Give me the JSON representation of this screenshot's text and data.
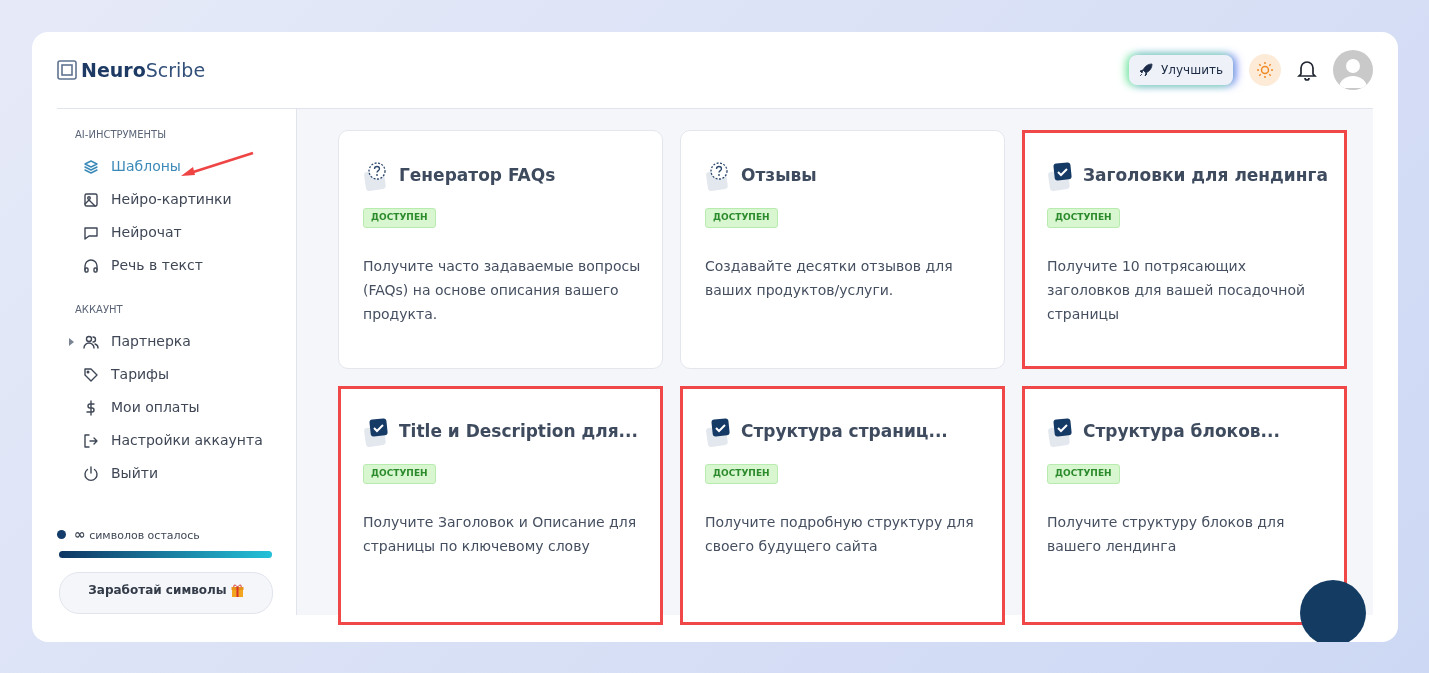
{
  "brand": {
    "bold": "Neuro",
    "light": "Scribe"
  },
  "header": {
    "upgrade_button": "Улучшить"
  },
  "sidebar": {
    "sections": [
      {
        "title": "AI-ИНСТРУМЕНТЫ",
        "items": [
          {
            "label": "Шаблоны",
            "selected": true,
            "annotated": true
          },
          {
            "label": "Нейро-картинки",
            "selected": false,
            "annotated": false
          },
          {
            "label": "Нейрочат",
            "selected": false,
            "annotated": false
          },
          {
            "label": "Речь в текст",
            "selected": false,
            "annotated": false
          }
        ]
      },
      {
        "title": "АККАУНТ",
        "items": [
          {
            "label": "Партнерка",
            "selected": false,
            "annotated": false,
            "expanded": false
          },
          {
            "label": "Тарифы",
            "selected": false,
            "annotated": false
          },
          {
            "label": "Мои оплаты",
            "selected": false,
            "annotated": false
          },
          {
            "label": "Настройки аккаунта",
            "selected": false,
            "annotated": false
          },
          {
            "label": "Выйти",
            "selected": false,
            "annotated": false
          }
        ]
      }
    ],
    "credits": {
      "amount": "∞",
      "label": "символов осталось",
      "level": 1
    },
    "earn_button": "Заработай символы"
  },
  "cards": [
    {
      "kind": "question",
      "title": "Генератор FAQs",
      "badge": "ДОСТУПЕН",
      "description": "Получите часто задаваемые вопросы (FAQs) на основе описания вашего продукта.",
      "highlighted": false
    },
    {
      "kind": "question",
      "title": "Отзывы",
      "badge": "ДОСТУПЕН",
      "description": "Создавайте десятки отзывов для ваших продуктов/услуги.",
      "highlighted": false
    },
    {
      "kind": "checkbox",
      "title": "Заголовки для лендинга",
      "badge": "ДОСТУПЕН",
      "description": "Получите 10 потрясающих заголовков для вашей посадочной страницы",
      "highlighted": true
    },
    {
      "kind": "checkbox",
      "title": "Title и Description для...",
      "badge": "ДОСТУПЕН",
      "description": "Получите Заголовок и Описание для страницы по ключевому слову",
      "highlighted": true
    },
    {
      "kind": "checkbox",
      "title": "Структура страниц...",
      "badge": "ДОСТУПЕН",
      "description": "Получите подробную структуру для своего будущего сайта",
      "highlighted": true
    },
    {
      "kind": "checkbox",
      "title": "Структура блоков...",
      "badge": "ДОСТУПЕН",
      "description": "Получите структуру блоков для вашего лендинга",
      "highlighted": true
    }
  ]
}
